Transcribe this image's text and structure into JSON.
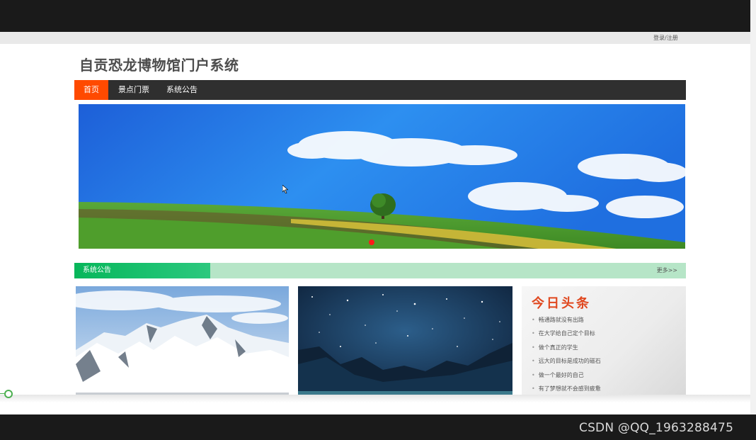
{
  "header": {
    "login_label": "登录/注册",
    "site_title": "自贡恐龙博物馆门户系统"
  },
  "nav": {
    "items": [
      {
        "label": "首页",
        "active": true
      },
      {
        "label": "景点门票"
      },
      {
        "label": "系统公告"
      }
    ]
  },
  "section": {
    "title": "系统公告",
    "more_label": "更多>>"
  },
  "news": {
    "title": "今日头条",
    "items": [
      "畅通路就没有出路",
      "在大学给自己定个目标",
      "做个真正的学生",
      "远大的目标是成功的磁石",
      "做一个最好的自己",
      "有了梦想就不会感到疲惫"
    ]
  },
  "colors": {
    "nav_active": "#ff4a00",
    "section_accent": "#07b65a",
    "news_title": "#e0481f"
  },
  "watermark": "CSDN @QQ_1963288475"
}
